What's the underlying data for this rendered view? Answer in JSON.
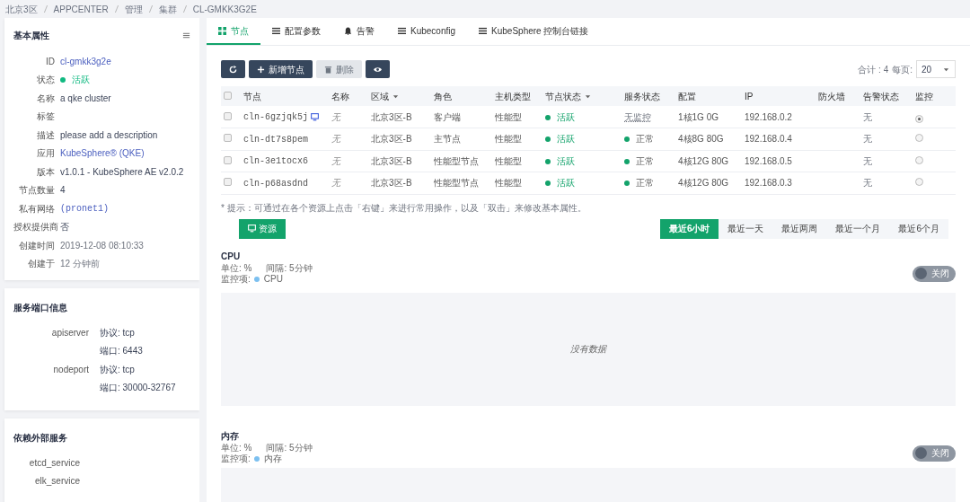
{
  "breadcrumb": [
    "北京3区",
    "APPCENTER",
    "管理",
    "集群",
    "CL-GMKK3G2E"
  ],
  "basic_properties": {
    "title": "基本属性",
    "rows": [
      {
        "label": "ID",
        "value": "cl-gmkk3g2e",
        "kind": "link"
      },
      {
        "label": "状态",
        "value": "活跃",
        "kind": "status",
        "color": "#10b981"
      },
      {
        "label": "名称",
        "value": "a qke cluster",
        "kind": "text"
      },
      {
        "label": "标签"
      },
      {
        "label": "描述",
        "value": "please add a description",
        "kind": "text"
      },
      {
        "label": "应用",
        "value": "KubeSphere® (QKE)",
        "kind": "link"
      },
      {
        "label": "版本",
        "value": "v1.0.1 - KubeSphere AE v2.0.2",
        "kind": "text"
      },
      {
        "label": "节点数量",
        "value": "4",
        "kind": "text"
      },
      {
        "label": "私有网络",
        "value": "(pronet1)",
        "kind": "mono"
      },
      {
        "label": "授权提供商",
        "value": "否",
        "kind": "text"
      },
      {
        "label": "创建时间",
        "value": "2019-12-08 08:10:33",
        "kind": "muted"
      },
      {
        "label": "创建于",
        "value": "12 分钟前",
        "kind": "muted"
      }
    ]
  },
  "service_ports": {
    "title": "服务端口信息",
    "rows": [
      {
        "name": "apiserver",
        "lines": [
          "协议: tcp",
          "端口: 6443"
        ]
      },
      {
        "name": "nodeport",
        "lines": [
          "协议: tcp",
          "端口: 30000-32767"
        ]
      }
    ]
  },
  "dependencies": {
    "title": "依赖外部服务",
    "items": [
      "etcd_service",
      "elk_service"
    ]
  },
  "tabs": [
    {
      "label": "节点",
      "selected": true
    },
    {
      "label": "配置参数",
      "selected": false
    },
    {
      "label": "告警",
      "selected": false
    },
    {
      "label": "Kubeconfig",
      "selected": false
    },
    {
      "label": "KubeSphere 控制台链接",
      "selected": false
    }
  ],
  "toolbar": {
    "add_label": "新增节点",
    "delete_label": "删除",
    "delete_disabled": true
  },
  "pagination": {
    "total": "合计 : 4",
    "per_page_label": "每页:",
    "per_page": "20"
  },
  "table": {
    "all_checked": false,
    "columns": [
      {
        "label": "节点",
        "sortable": false
      },
      {
        "label": "名称",
        "sortable": false
      },
      {
        "label": "区域",
        "sortable": true
      },
      {
        "label": "角色",
        "sortable": false
      },
      {
        "label": "主机类型",
        "sortable": false
      },
      {
        "label": "节点状态",
        "sortable": true
      },
      {
        "label": "服务状态",
        "sortable": false
      },
      {
        "label": "配置",
        "sortable": false
      },
      {
        "label": "IP",
        "sortable": false
      },
      {
        "label": "防火墙",
        "sortable": false
      },
      {
        "label": "告警状态",
        "sortable": false
      },
      {
        "label": "监控",
        "sortable": false
      }
    ],
    "rows": [
      {
        "checked": false,
        "node": "cln-6gzjqk5j",
        "console": true,
        "name": "无",
        "zone": "北京3区-B",
        "role": "客户端",
        "host_type": "性能型",
        "node_status": "活跃",
        "service_status": "无监控",
        "service_ok": false,
        "config": "1核1G 0G",
        "ip": "192.168.0.2",
        "alert": "无",
        "selected": true
      },
      {
        "checked": false,
        "node": "cln-dt7s8pem",
        "console": false,
        "name": "无",
        "zone": "北京3区-B",
        "role": "主节点",
        "host_type": "性能型",
        "node_status": "活跃",
        "service_status": "正常",
        "service_ok": true,
        "config": "4核8G 80G",
        "ip": "192.168.0.4",
        "alert": "无",
        "selected": false
      },
      {
        "checked": false,
        "node": "cln-3e1tocx6",
        "console": false,
        "name": "无",
        "zone": "北京3区-B",
        "role": "性能型节点",
        "host_type": "性能型",
        "node_status": "活跃",
        "service_status": "正常",
        "service_ok": true,
        "config": "4核12G 80G",
        "ip": "192.168.0.5",
        "alert": "无",
        "selected": false
      },
      {
        "checked": false,
        "node": "cln-p68asdnd",
        "console": false,
        "name": "无",
        "zone": "北京3区-B",
        "role": "性能型节点",
        "host_type": "性能型",
        "node_status": "活跃",
        "service_status": "正常",
        "service_ok": true,
        "config": "4核12G 80G",
        "ip": "192.168.0.3",
        "alert": "无",
        "selected": false
      }
    ]
  },
  "hint": "* 提示：可通过在各个资源上点击「右键」来进行常用操作，以及「双击」来修改基本属性。",
  "resource_button": "资源",
  "time_ranges": [
    {
      "label": "最近6小时",
      "selected": true
    },
    {
      "label": "最近一天",
      "selected": false
    },
    {
      "label": "最近两周",
      "selected": false
    },
    {
      "label": "最近一个月",
      "selected": false
    },
    {
      "label": "最近6个月",
      "selected": false
    }
  ],
  "metrics": [
    {
      "title": "CPU",
      "unit": "单位: %",
      "interval": "间隔: 5分钟",
      "monitor_label": "监控项:",
      "legend": "CPU",
      "toggle_label": "关闭",
      "on": false,
      "empty_text": "没有数据"
    },
    {
      "title": "内存",
      "unit": "单位: %",
      "interval": "间隔: 5分钟",
      "monitor_label": "监控项:",
      "legend": "内存",
      "toggle_label": "关闭",
      "on": false
    }
  ]
}
